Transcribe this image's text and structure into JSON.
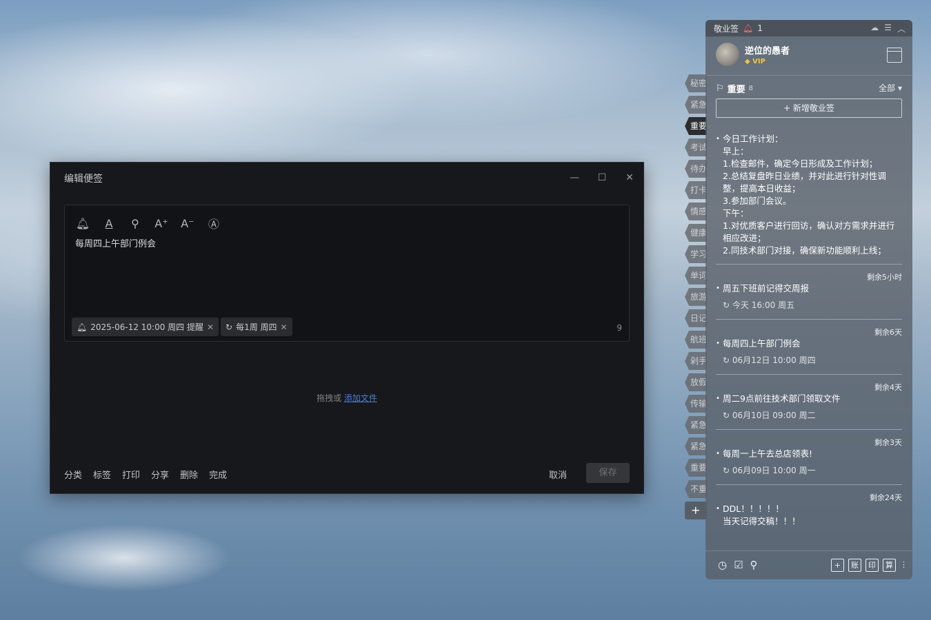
{
  "editor": {
    "title": "编辑便签",
    "toolbar_icons": [
      "bell-icon",
      "text-color-icon",
      "search-icon",
      "font-increase-icon",
      "font-decrease-icon",
      "text-style-icon"
    ],
    "content": "每周四上午部门例会",
    "reminder_chip": "2025-06-12 10:00 周四 提醒",
    "repeat_chip": "每1周 周四",
    "char_count": "9",
    "drop_text": "拖拽或",
    "add_file": "添加文件",
    "footer": [
      "分类",
      "标签",
      "打印",
      "分享",
      "删除",
      "完成"
    ],
    "cancel": "取消",
    "save": "保存"
  },
  "tabs": [
    "秘密",
    "紧急",
    "重要",
    "考试",
    "待办",
    "打卡",
    "情感",
    "健康",
    "学习",
    "单词",
    "旅游",
    "日记",
    "航班",
    "剁手",
    "放假",
    "传输",
    "紧急",
    "紧急",
    "重要",
    "不重"
  ],
  "panel": {
    "app_name": "敬业签",
    "notif_count": "1",
    "user": "逆位的愚者",
    "vip": "VIP",
    "category": "重要",
    "category_count": "8",
    "filter": "全部",
    "new_button": "+ 新增敬业签",
    "notes": [
      {
        "remaining": "",
        "text": "今日工作计划：\n早上：\n1.检查邮件，确定今日形成及工作计划；\n2.总结复盘昨日业绩，并对此进行针对性调整，提高本日收益；\n3.参加部门会议。\n下午：\n1.对优质客户进行回访，确认对方需求并进行相应改进；\n2.同技术部门对接，确保新功能顺利上线；",
        "time": ""
      },
      {
        "remaining": "剩余5小时",
        "text": "周五下班前记得交周报",
        "time": "今天 16:00 周五"
      },
      {
        "remaining": "剩余6天",
        "text": "每周四上午部门例会",
        "time": "06月12日 10:00 周四"
      },
      {
        "remaining": "剩余4天",
        "text": "周二9点前往技术部门领取文件",
        "time": "06月10日 09:00 周二"
      },
      {
        "remaining": "剩余3天",
        "text": "每周一上午去总店领表!",
        "time": "06月09日 10:00 周一"
      },
      {
        "remaining": "剩余24天",
        "text": "DDL！！！！！\n当天记得交稿！！！",
        "time": ""
      }
    ],
    "bottom_right": [
      "+",
      "账",
      "印",
      "算"
    ]
  }
}
